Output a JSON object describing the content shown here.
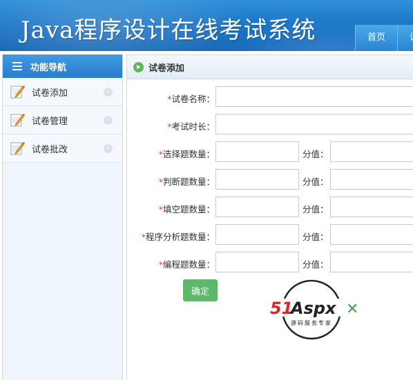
{
  "header": {
    "title": "Java程序设计在线考试系统",
    "nav": [
      "首页",
      "试"
    ]
  },
  "sidebar": {
    "title": "功能导航",
    "items": [
      {
        "label": "试卷添加"
      },
      {
        "label": "试卷管理"
      },
      {
        "label": "试卷批改"
      }
    ]
  },
  "main": {
    "title": "试卷添加",
    "required_mark": "*",
    "fields": [
      {
        "label": "试卷名称：",
        "value": ""
      },
      {
        "label": "考试时长：",
        "value": ""
      }
    ],
    "count_fields": [
      {
        "label": "选择题数量：",
        "value": "",
        "score_label": "分值：",
        "score_value": ""
      },
      {
        "label": "判断题数量：",
        "value": "",
        "score_label": "分值：",
        "score_value": ""
      },
      {
        "label": "填空题数量：",
        "value": "",
        "score_label": "分值：",
        "score_value": ""
      },
      {
        "label": "程序分析题数量：",
        "value": "",
        "score_label": "分值：",
        "score_value": ""
      },
      {
        "label": "编程题数量：",
        "value": "",
        "score_label": "分值：",
        "score_value": ""
      }
    ],
    "submit_label": "确定"
  },
  "watermark": {
    "brand": "51Aspx",
    "tagline": "源码服务专家"
  },
  "colors": {
    "header_blue": "#1a73c4",
    "accent_green": "#5cb86b",
    "required_red": "#e4393c"
  }
}
